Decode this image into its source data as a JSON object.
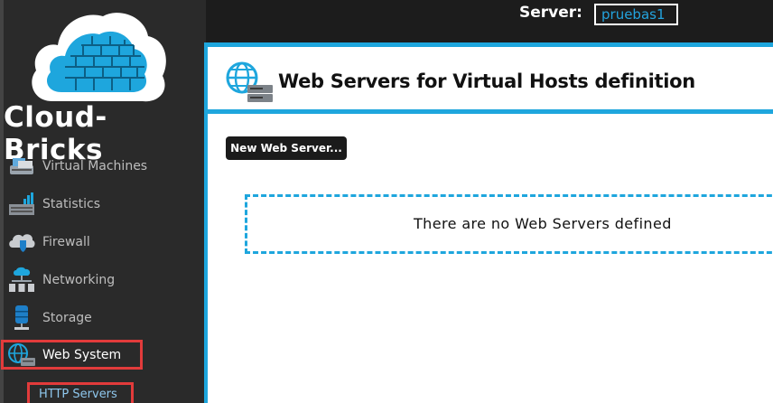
{
  "brand": {
    "name": "Cloud-Bricks"
  },
  "header": {
    "server_label": "Server:",
    "server_value": "pruebas1"
  },
  "sidebar": {
    "items": [
      {
        "label": "Virtual Machines",
        "icon": "virtual-machines-icon"
      },
      {
        "label": "Statistics",
        "icon": "statistics-icon"
      },
      {
        "label": "Firewall",
        "icon": "firewall-icon"
      },
      {
        "label": "Networking",
        "icon": "networking-icon"
      },
      {
        "label": "Storage",
        "icon": "storage-icon"
      },
      {
        "label": "Web System",
        "icon": "web-system-icon"
      }
    ],
    "subitems": [
      {
        "label": "HTTP Servers"
      }
    ]
  },
  "main": {
    "title": "Web Servers for Virtual Hosts definition",
    "new_button": "New Web Server...",
    "empty_message": "There are no Web Servers defined"
  },
  "colors": {
    "accent": "#1ea6dd",
    "highlight": "#e23b3b",
    "sidebar": "#2a2a2a",
    "subitem": "#8fc8ee"
  }
}
